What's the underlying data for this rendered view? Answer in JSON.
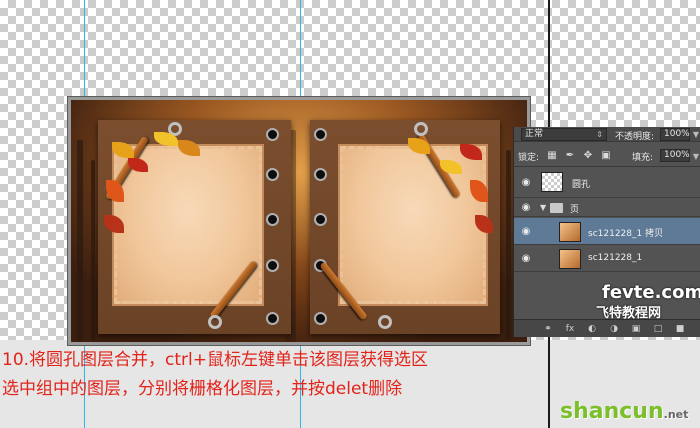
{
  "caption": {
    "line1": "10.将圆孔图层合并，ctrl+鼠标左键单击该图层获得选区",
    "line2": "选中组中的图层，分别将栅格化图层，并按delet删除"
  },
  "layers_panel": {
    "blend_mode": "正常",
    "opacity_label": "不透明度:",
    "opacity_value": "100%",
    "lock_label": "锁定:",
    "fill_label": "填充:",
    "fill_value": "100%",
    "layers": [
      {
        "name": "圆孔",
        "visible": true,
        "selected": false,
        "type": "layer"
      },
      {
        "name": "页",
        "visible": true,
        "selected": false,
        "type": "group"
      },
      {
        "name": "sc121228_1 拷贝",
        "visible": true,
        "selected": true,
        "type": "layer"
      },
      {
        "name": "sc121228_1",
        "visible": true,
        "selected": false,
        "type": "layer"
      }
    ],
    "bottom_icons": [
      "link-icon",
      "fx-icon",
      "mask-icon",
      "adjustment-icon",
      "folder-icon",
      "new-layer-icon",
      "trash-icon"
    ],
    "fx_label": "fx"
  },
  "watermarks": {
    "site1": "fevte.com",
    "site1_cn": "飞特教程网",
    "site2": "shancun",
    "site2_suffix": ".net"
  },
  "colors": {
    "caption": "#e2231a",
    "selection": "#5e7a96",
    "panel": "#535353"
  }
}
